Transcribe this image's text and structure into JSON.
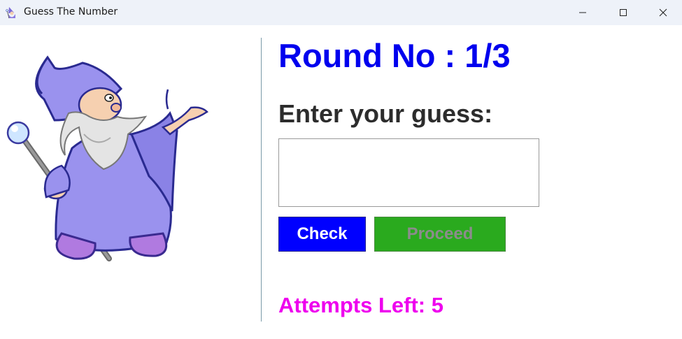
{
  "window": {
    "title": "Guess The Number",
    "app_icon": "wizard-icon",
    "controls": [
      "minimize-icon",
      "maximize-icon",
      "close-icon"
    ]
  },
  "game": {
    "round_text": "Round No : 1/3",
    "prompt": "Enter your guess:",
    "guess_value": "",
    "check_label": "Check",
    "proceed_label": "Proceed",
    "attempts_text": "Attempts Left: 5"
  },
  "colors": {
    "round": "#0000ee",
    "check_button": "#0000ff",
    "proceed_button": "#2aaa1e",
    "attempts": "#ee00ee"
  }
}
